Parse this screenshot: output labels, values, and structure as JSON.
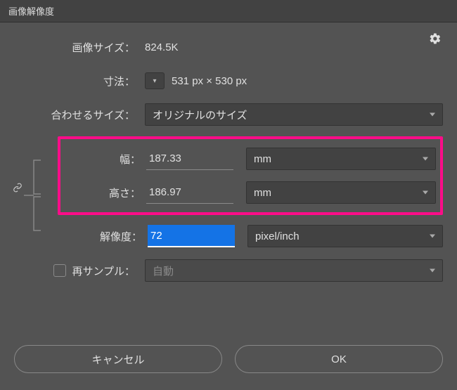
{
  "dialog": {
    "title": "画像解像度",
    "imageSize": {
      "label": "画像サイズ：",
      "value": "824.5K"
    },
    "dimensions": {
      "label": "寸法：",
      "value": "531 px × 530 px"
    },
    "fitTo": {
      "label": "合わせるサイズ：",
      "value": "オリジナルのサイズ"
    },
    "width": {
      "label": "幅：",
      "value": "187.33",
      "unit": "mm"
    },
    "height": {
      "label": "高さ：",
      "value": "186.97",
      "unit": "mm"
    },
    "resolution": {
      "label": "解像度：",
      "value": "72",
      "unit": "pixel/inch"
    },
    "resample": {
      "label": "再サンプル：",
      "value": "自動"
    },
    "buttons": {
      "cancel": "キャンセル",
      "ok": "OK"
    }
  }
}
